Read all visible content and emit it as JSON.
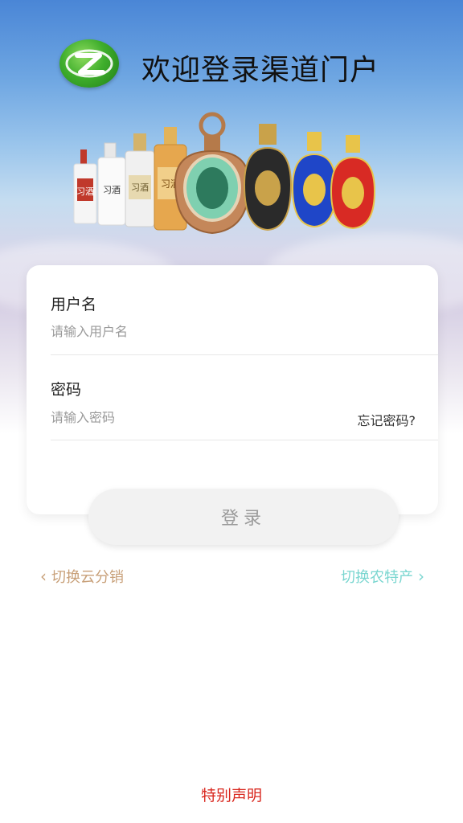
{
  "header": {
    "title": "欢迎登录渠道门户",
    "logo_icon": "z-logo-icon"
  },
  "banner": {
    "product_labels": [
      "习酒",
      "习酒",
      "习酒",
      "习酒"
    ]
  },
  "form": {
    "username_label": "用户名",
    "username_placeholder": "请输入用户名",
    "password_label": "密码",
    "password_placeholder": "请输入密码",
    "forgot_label": "忘记密码?"
  },
  "login_button": "登录",
  "switch": {
    "left_label": "切换云分销",
    "right_label": "切换农特产",
    "left_icon": "chevron-left-icon",
    "right_icon": "chevron-right-icon"
  },
  "footer": {
    "special_statement": "特别声明"
  },
  "colors": {
    "accent_gold": "#c8a079",
    "accent_teal": "#7ad6d0",
    "statement_red": "#d9281f",
    "logo_green": "#3fae2c"
  }
}
